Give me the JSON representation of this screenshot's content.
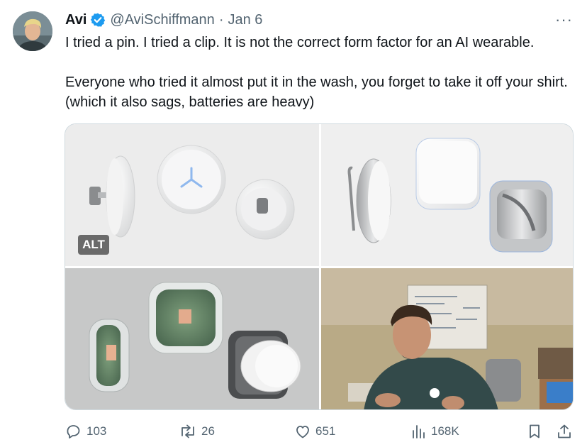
{
  "tweet": {
    "author": {
      "name": "Avi",
      "handle": "@AviSchiffmann",
      "separator": "·",
      "date": "Jan 6",
      "verified": true
    },
    "more_label": "···",
    "text_lines": [
      "I tried a pin. I tried a clip. It is not the correct form factor for an AI wearable.",
      "Everyone who tried it almost put it in the wash, you forget to take it off your shirt. (which it also sags, batteries are heavy)"
    ],
    "media": {
      "alt_badge": "ALT",
      "images": [
        {
          "name": "white-wearable-renders"
        },
        {
          "name": "clip-and-silver-wearable-renders"
        },
        {
          "name": "transparent-circuit-wearable-renders"
        },
        {
          "name": "person-wearing-pin-video-frame"
        }
      ]
    },
    "actions": {
      "reply_count": "103",
      "retweet_count": "26",
      "like_count": "651",
      "view_count": "168K"
    }
  },
  "colors": {
    "text_primary": "#0f1419",
    "text_secondary": "#536471",
    "verified_blue": "#1d9bf0",
    "border": "#cfd9de"
  },
  "icons": [
    "verified-badge-icon",
    "more-icon",
    "reply-icon",
    "retweet-icon",
    "like-icon",
    "views-icon",
    "bookmark-icon",
    "share-icon"
  ]
}
